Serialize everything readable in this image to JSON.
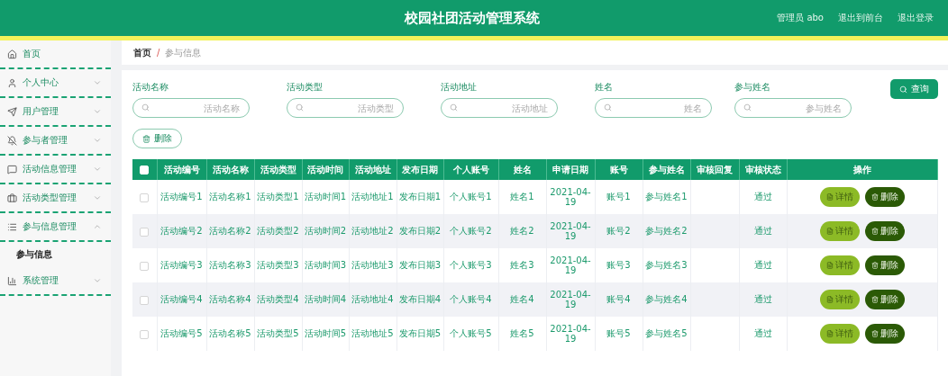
{
  "header": {
    "title": "校园社团活动管理系统",
    "links": [
      "管理员 abo",
      "退出到前台",
      "退出登录"
    ]
  },
  "sidebar": {
    "items": [
      {
        "kind": "link",
        "label": "首页"
      },
      {
        "kind": "menu",
        "label": "个人中心",
        "expanded": false
      },
      {
        "kind": "menu",
        "label": "用户管理",
        "expanded": false
      },
      {
        "kind": "menu",
        "label": "参与者管理",
        "expanded": false
      },
      {
        "kind": "menu",
        "label": "活动信息管理",
        "expanded": false
      },
      {
        "kind": "menu",
        "label": "活动类型管理",
        "expanded": false
      },
      {
        "kind": "menu",
        "label": "参与信息管理",
        "expanded": true,
        "children": [
          {
            "label": "参与信息",
            "selected": true
          }
        ]
      },
      {
        "kind": "menu",
        "label": "系统管理",
        "expanded": false
      }
    ]
  },
  "breadcrumb": {
    "separator": "/",
    "items": [
      "首页",
      "参与信息"
    ]
  },
  "search": {
    "fields": [
      {
        "label": "活动名称",
        "placeholder": "活动名称"
      },
      {
        "label": "活动类型",
        "placeholder": "活动类型"
      },
      {
        "label": "活动地址",
        "placeholder": "活动地址"
      },
      {
        "label": "姓名",
        "placeholder": "姓名"
      },
      {
        "label": "参与姓名",
        "placeholder": "参与姓名"
      }
    ],
    "query_button": "查询",
    "delete_button": "删除"
  },
  "table": {
    "select_all_checked": false,
    "columns": [
      "活动编号",
      "活动名称",
      "活动类型",
      "活动时间",
      "活动地址",
      "发布日期",
      "个人账号",
      "姓名",
      "申请日期",
      "账号",
      "参与姓名",
      "审核回复",
      "审核状态",
      "操作"
    ],
    "rows": [
      {
        "checked": false,
        "cells": [
          "活动编号1",
          "活动名称1",
          "活动类型1",
          "活动时间1",
          "活动地址1",
          "发布日期1",
          "个人账号1",
          "姓名1",
          "2021-04-19",
          "账号1",
          "参与姓名1",
          "",
          "通过"
        ],
        "actions": [
          "详情",
          "删除"
        ]
      },
      {
        "checked": false,
        "cells": [
          "活动编号2",
          "活动名称2",
          "活动类型2",
          "活动时间2",
          "活动地址2",
          "发布日期2",
          "个人账号2",
          "姓名2",
          "2021-04-19",
          "账号2",
          "参与姓名2",
          "",
          "通过"
        ],
        "actions": [
          "详情",
          "删除"
        ]
      },
      {
        "checked": false,
        "cells": [
          "活动编号3",
          "活动名称3",
          "活动类型3",
          "活动时间3",
          "活动地址3",
          "发布日期3",
          "个人账号3",
          "姓名3",
          "2021-04-19",
          "账号3",
          "参与姓名3",
          "",
          "通过"
        ],
        "actions": [
          "详情",
          "删除"
        ]
      },
      {
        "checked": false,
        "cells": [
          "活动编号4",
          "活动名称4",
          "活动类型4",
          "活动时间4",
          "活动地址4",
          "发布日期4",
          "个人账号4",
          "姓名4",
          "2021-04-19",
          "账号4",
          "参与姓名4",
          "",
          "通过"
        ],
        "actions": [
          "详情",
          "删除"
        ]
      },
      {
        "checked": false,
        "cells": [
          "活动编号5",
          "活动名称5",
          "活动类型5",
          "活动时间5",
          "活动地址5",
          "发布日期5",
          "个人账号5",
          "姓名5",
          "2021-04-19",
          "账号5",
          "参与姓名5",
          "",
          "通过"
        ],
        "actions": [
          "详情",
          "删除"
        ]
      }
    ]
  }
}
